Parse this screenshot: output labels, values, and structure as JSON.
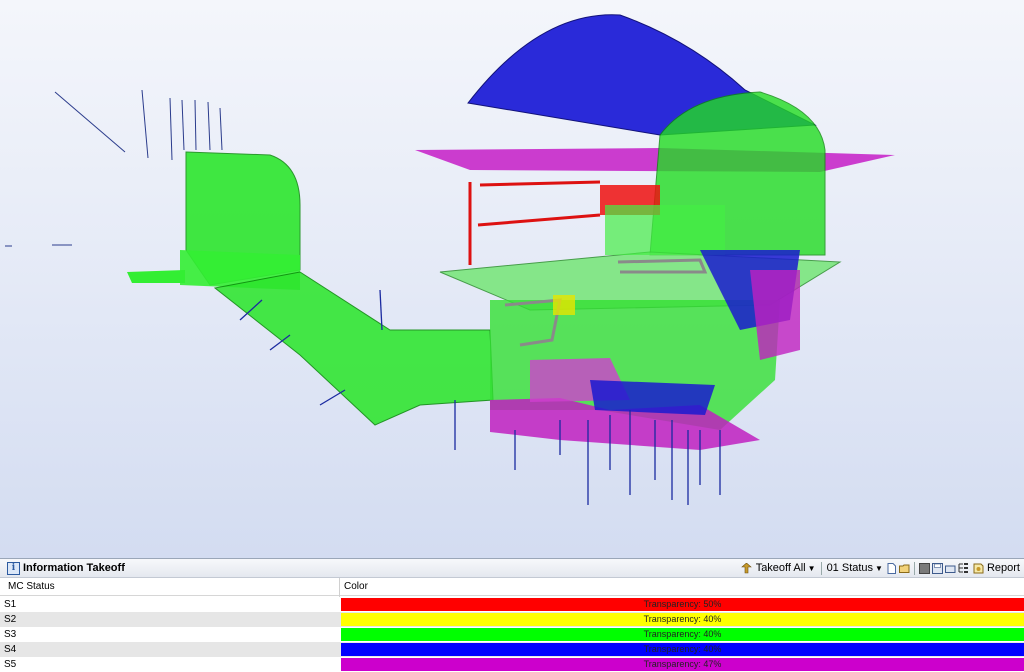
{
  "viewport": {
    "description_icon": "3d-model-view"
  },
  "panel": {
    "title": "Information Takeoff",
    "toolbar": {
      "takeoff_all": "Takeoff All",
      "status_select": "01 Status",
      "report": "Report"
    },
    "columns": {
      "status": "MC Status",
      "color": "Color"
    },
    "rows": [
      {
        "status": "S1",
        "transparency": "Transparency: 50%",
        "color": "#ff0000"
      },
      {
        "status": "S2",
        "transparency": "Transparency: 40%",
        "color": "#ffff00"
      },
      {
        "status": "S3",
        "transparency": "Transparency: 40%",
        "color": "#00ff00"
      },
      {
        "status": "S4",
        "transparency": "Transparency: 40%",
        "color": "#0000ff"
      },
      {
        "status": "S5",
        "transparency": "Transparency: 47%",
        "color": "#cc00cc"
      }
    ]
  }
}
